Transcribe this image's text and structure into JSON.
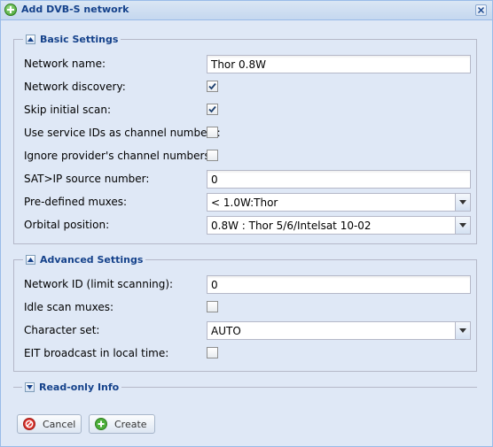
{
  "window": {
    "title": "Add DVB-S network"
  },
  "basic": {
    "legend": "Basic Settings",
    "network_name": {
      "label": "Network name:",
      "value": "Thor 0.8W"
    },
    "network_discovery": {
      "label": "Network discovery:",
      "checked": true
    },
    "skip_initial_scan": {
      "label": "Skip initial scan:",
      "checked": true
    },
    "use_service_ids": {
      "label": "Use service IDs as channel numbers:",
      "checked": false
    },
    "ignore_provider": {
      "label": "Ignore provider's channel numbers:",
      "checked": false
    },
    "satip_source": {
      "label": "SAT>IP source number:",
      "value": "0"
    },
    "predefined_muxes": {
      "label": "Pre-defined muxes:",
      "value": "<  1.0W:Thor"
    },
    "orbital_position": {
      "label": "Orbital position:",
      "value": "0.8W : Thor 5/6/Intelsat 10-02"
    }
  },
  "advanced": {
    "legend": "Advanced Settings",
    "network_id": {
      "label": "Network ID (limit scanning):",
      "value": "0"
    },
    "idle_scan_muxes": {
      "label": "Idle scan muxes:",
      "checked": false
    },
    "character_set": {
      "label": "Character set:",
      "value": "AUTO"
    },
    "eit_local_time": {
      "label": "EIT broadcast in local time:",
      "checked": false
    }
  },
  "readonly": {
    "legend": "Read-only Info",
    "collapsed": true
  },
  "buttons": {
    "cancel": "Cancel",
    "create": "Create"
  },
  "colors": {
    "title": "#15428b",
    "panel_bg": "#dfe8f6",
    "border": "#b5b8c8",
    "cancel_icon": "#d9312b",
    "create_icon": "#4caf3a"
  }
}
